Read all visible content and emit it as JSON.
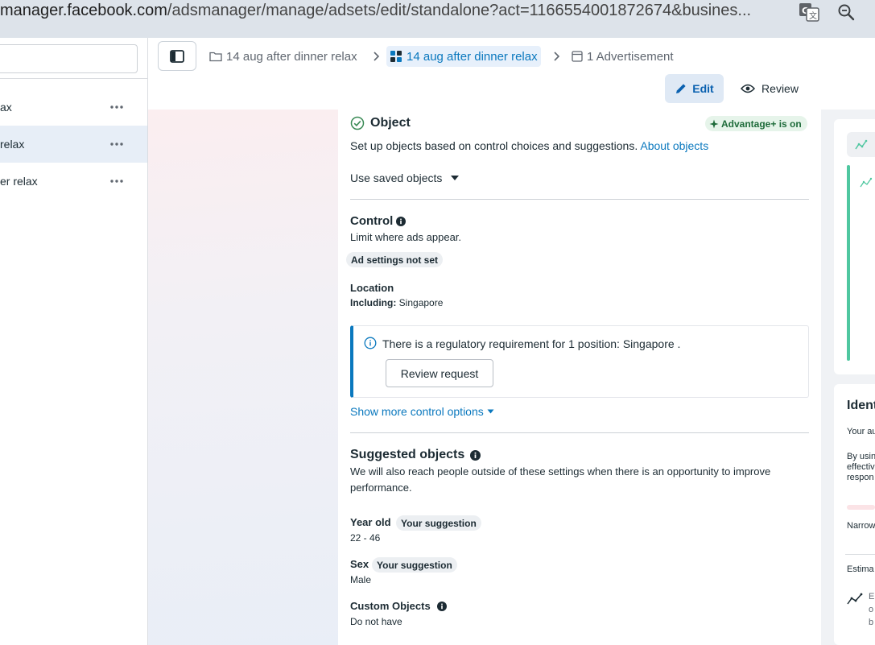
{
  "browser": {
    "url_host": "manager.facebook.com",
    "url_path": "/adsmanager/manage/adsets/edit/standalone?act=1166554001872674&busines..."
  },
  "left_panel": {
    "items": [
      {
        "label": "ax"
      },
      {
        "label": "relax"
      },
      {
        "label": "er relax"
      }
    ]
  },
  "toolbar": {
    "breadcrumbs": [
      {
        "label": "14 aug after dinner relax"
      },
      {
        "label": "14 aug after dinner relax"
      },
      {
        "label": "1 Advertisement"
      }
    ],
    "edit_label": "Edit",
    "review_label": "Review"
  },
  "object_section": {
    "title": "Object",
    "advantage_badge": "Advantage+ is on",
    "description": "Set up objects based on control choices and suggestions.",
    "about_link": "About objects",
    "saved_objects": "Use saved objects"
  },
  "control_section": {
    "title": "Control",
    "description": "Limit where ads appear.",
    "ad_settings_pill": "Ad settings not set",
    "location_title": "Location",
    "including_label": "Including:",
    "including_value": "Singapore",
    "notice_text": "There is a regulatory requirement for 1 position: Singapore .",
    "review_request": "Review request",
    "show_more": "Show more control options"
  },
  "suggested_section": {
    "title": "Suggested objects",
    "description_line1": "We will also reach people outside of these settings when there is an opportunity to improve",
    "description_line2": "performance.",
    "age_title": "Year old",
    "age_pill": "Your suggestion",
    "age_value": "22 - 46",
    "sex_title": "Sex",
    "sex_pill": "Your suggestion",
    "sex_value": "Male",
    "custom_title": "Custom Objects",
    "custom_value": "Do not have"
  },
  "right_panel": {
    "heading": "Ident",
    "line1": "Your au",
    "line2a": "By usin",
    "line2b": "effectiv",
    "line2c": "respon",
    "narrow": "Narrow",
    "estimate": "Estima",
    "est_a": "E",
    "est_b": "o",
    "est_c": "b"
  },
  "colors": {
    "accent_blue": "#0a78be",
    "advantage_green": "#1e6b3a",
    "chart_green": "#4fc7a0"
  }
}
